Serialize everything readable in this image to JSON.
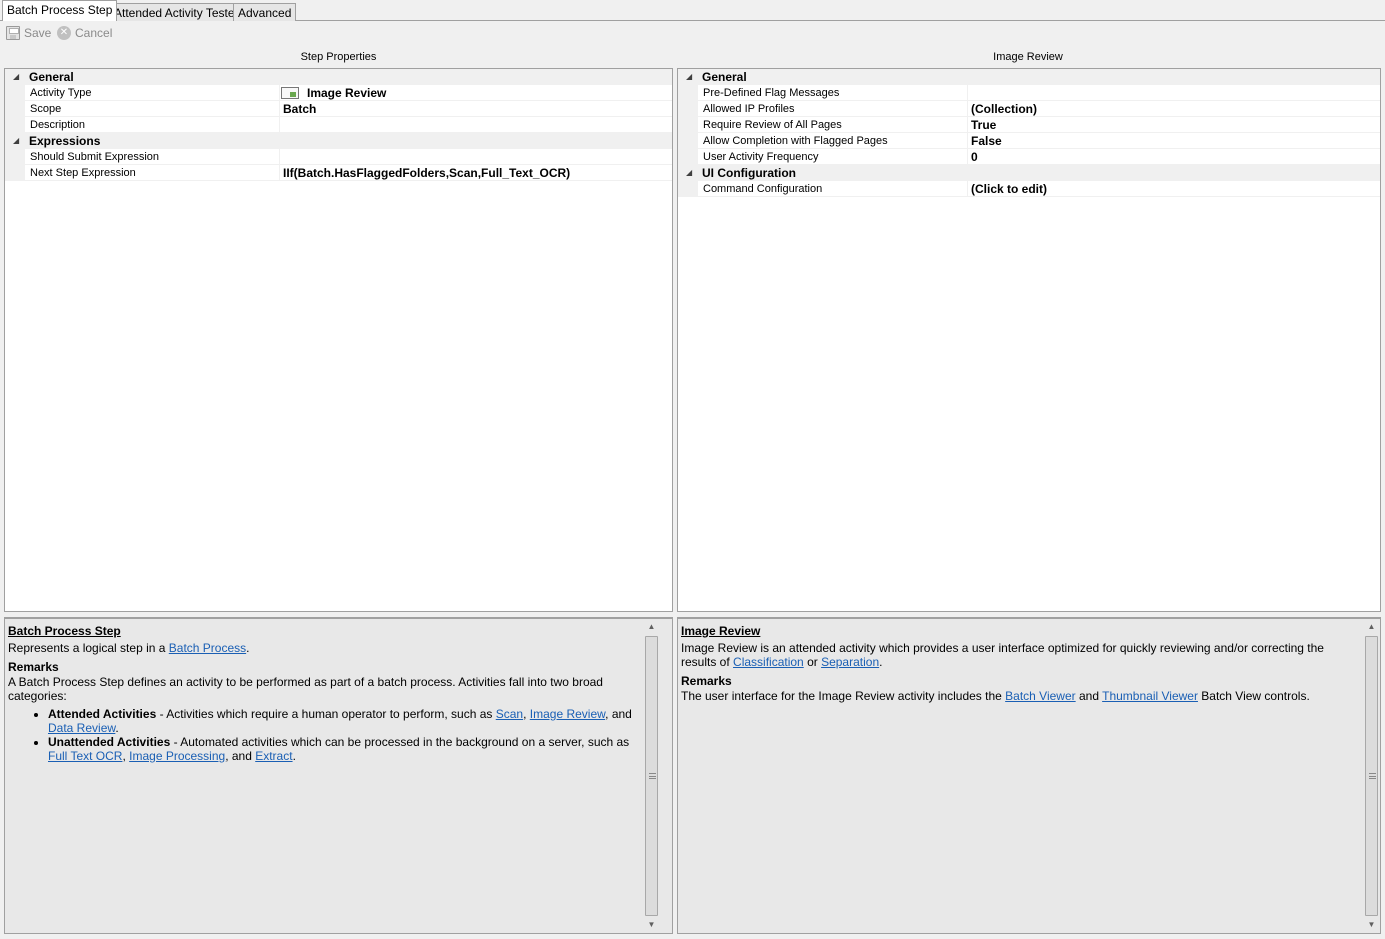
{
  "tabs": [
    {
      "label": "Batch Process Step",
      "active": true
    },
    {
      "label": "Attended Activity Tester",
      "active": false
    },
    {
      "label": "Advanced",
      "active": false
    }
  ],
  "toolbar": {
    "save_label": "Save",
    "cancel_label": "Cancel",
    "save_icon": "save-icon",
    "cancel_icon": "cancel-icon"
  },
  "left_pane": {
    "title": "Step Properties",
    "categories": [
      {
        "label": "General",
        "rows": [
          {
            "name": "Activity Type",
            "value": "Image Review",
            "icon": "activity-icon"
          },
          {
            "name": "Scope",
            "value": "Batch"
          },
          {
            "name": "Description",
            "value": ""
          }
        ]
      },
      {
        "label": "Expressions",
        "rows": [
          {
            "name": "Should Submit Expression",
            "value": ""
          },
          {
            "name": "Next Step Expression",
            "value": "IIf(Batch.HasFlaggedFolders,Scan,Full_Text_OCR)"
          }
        ]
      }
    ]
  },
  "right_pane": {
    "title": "Image Review",
    "categories": [
      {
        "label": "General",
        "rows": [
          {
            "name": "Pre-Defined Flag Messages",
            "value": ""
          },
          {
            "name": "Allowed IP Profiles",
            "value": "(Collection)"
          },
          {
            "name": "Require Review of All Pages",
            "value": "True"
          },
          {
            "name": "Allow Completion with Flagged Pages",
            "value": "False"
          },
          {
            "name": "User Activity Frequency",
            "value": "0"
          }
        ]
      },
      {
        "label": "UI Configuration",
        "rows": [
          {
            "name": "Command Configuration",
            "value": "(Click to edit)"
          }
        ]
      }
    ]
  },
  "left_help": {
    "title": "Batch Process Step",
    "summary_prefix": "Represents a logical step in a ",
    "summary_link": "Batch Process",
    "summary_suffix": ".",
    "remarks_label": "Remarks",
    "remarks_text": "A Batch Process Step defines an activity to be performed as part of a batch process. Activities fall into two broad categories:",
    "bullets": [
      {
        "bold": "Attended Activities",
        "text": " - Activities which require a human operator to perform, such as ",
        "links": [
          "Scan",
          "Image Review",
          "Data Review"
        ],
        "sep1": ", ",
        "sep2": ", and ",
        "end": "."
      },
      {
        "bold": "Unattended Activities",
        "text": " - Automated activities which can be processed in the background on a server, such as ",
        "links": [
          "Full Text OCR",
          "Image Processing",
          "Extract"
        ],
        "sep1": ", ",
        "sep2": ", and ",
        "end": "."
      }
    ]
  },
  "right_help": {
    "title": "Image Review",
    "summary": "Image Review is an attended activity which provides a user interface optimized for quickly reviewing and/or correcting the results of ",
    "link1": "Classification",
    "mid": " or ",
    "link2": "Separation",
    "end": ".",
    "remarks_label": "Remarks",
    "remarks_prefix": "The user interface for the Image Review activity includes the ",
    "remarks_link1": "Batch Viewer",
    "remarks_mid": " and ",
    "remarks_link2": "Thumbnail Viewer",
    "remarks_suffix": " Batch View controls."
  }
}
